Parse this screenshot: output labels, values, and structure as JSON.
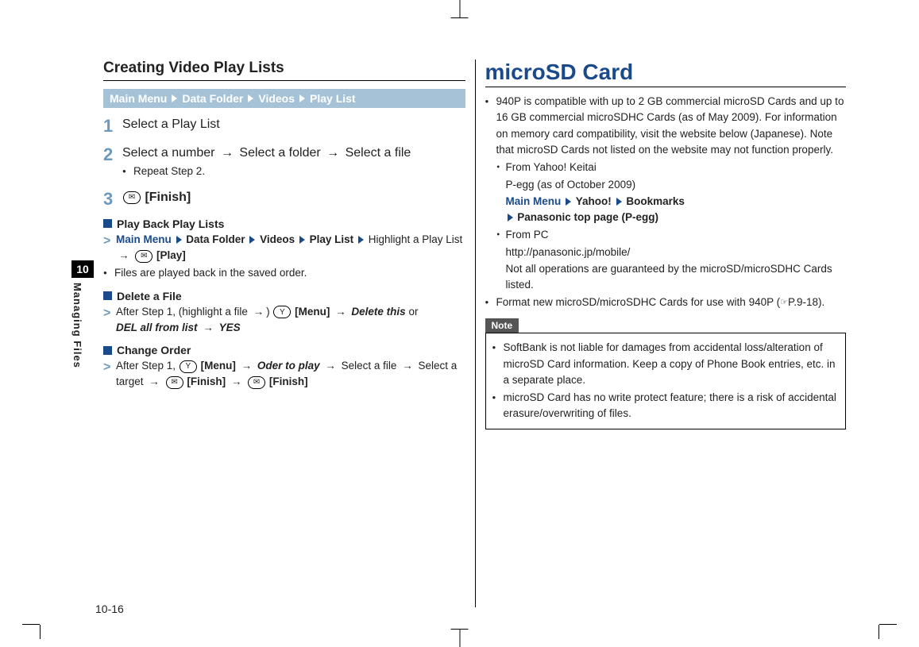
{
  "side": {
    "chapter": "10",
    "section": "Managing Files"
  },
  "page_number": "10-16",
  "left": {
    "heading": "Creating Video Play Lists",
    "nav": [
      "Main Menu",
      "Data Folder",
      "Videos",
      "Play List"
    ],
    "step1": "Select a Play List",
    "step2_a": "Select a number",
    "step2_b": "Select a folder",
    "step2_c": "Select a file",
    "step2_note": "Repeat Step 2.",
    "step3_key": "✉",
    "step3_label": "[Finish]",
    "sub_play_title": "Play Back Play Lists",
    "sub_play_nav_tail": "Highlight a Play List",
    "sub_play_action": "[Play]",
    "sub_play_note": "Files are played back in the saved order.",
    "sub_del_title": "Delete a File",
    "sub_del_line_a": "After Step 1, (highlight a file",
    "sub_del_menu_key": "Y",
    "sub_del_menu": "[Menu]",
    "sub_del_opt1": "Delete this",
    "sub_del_or": "or",
    "sub_del_opt2": "DEL all from list",
    "sub_del_yes": "YES",
    "sub_ord_title": "Change Order",
    "sub_ord_a": "After Step 1,",
    "sub_ord_menu_key": "Y",
    "sub_ord_menu": "[Menu]",
    "sub_ord_opt": "Oder to play",
    "sub_ord_b": "Select a file",
    "sub_ord_c": "Select a target",
    "sub_ord_finish_key": "✉",
    "sub_ord_finish": "[Finish]"
  },
  "right": {
    "title": "microSD Card",
    "p1": "940P is compatible with up to 2 GB commercial microSD Cards and up to 16 GB commercial microSDHC Cards (as of May 2009). For information on memory card compatibility, visit the website below (Japanese). Note that microSD Cards not listed on the website may not function properly.",
    "yahoo_label": "From Yahoo! Keitai",
    "yahoo_sub": "P-egg (as of October 2009)",
    "yahoo_nav": [
      "Main Menu",
      "Yahoo!",
      "Bookmarks",
      "Panasonic top page (P-egg)"
    ],
    "pc_label": "From PC",
    "pc_url": "http://panasonic.jp/mobile/",
    "pc_note": "Not all operations are guaranteed by the microSD/microSDHC Cards listed.",
    "p2_a": "Format new microSD/microSDHC Cards for use with 940P (",
    "p2_ref": "P.9-18",
    "p2_b": ").",
    "note_label": "Note",
    "note1": "SoftBank is not liable for damages from accidental loss/alteration of microSD Card information. Keep a copy of Phone Book entries, etc. in a separate place.",
    "note2": "microSD Card has no write protect feature; there is a risk of accidental erasure/overwriting of files."
  }
}
